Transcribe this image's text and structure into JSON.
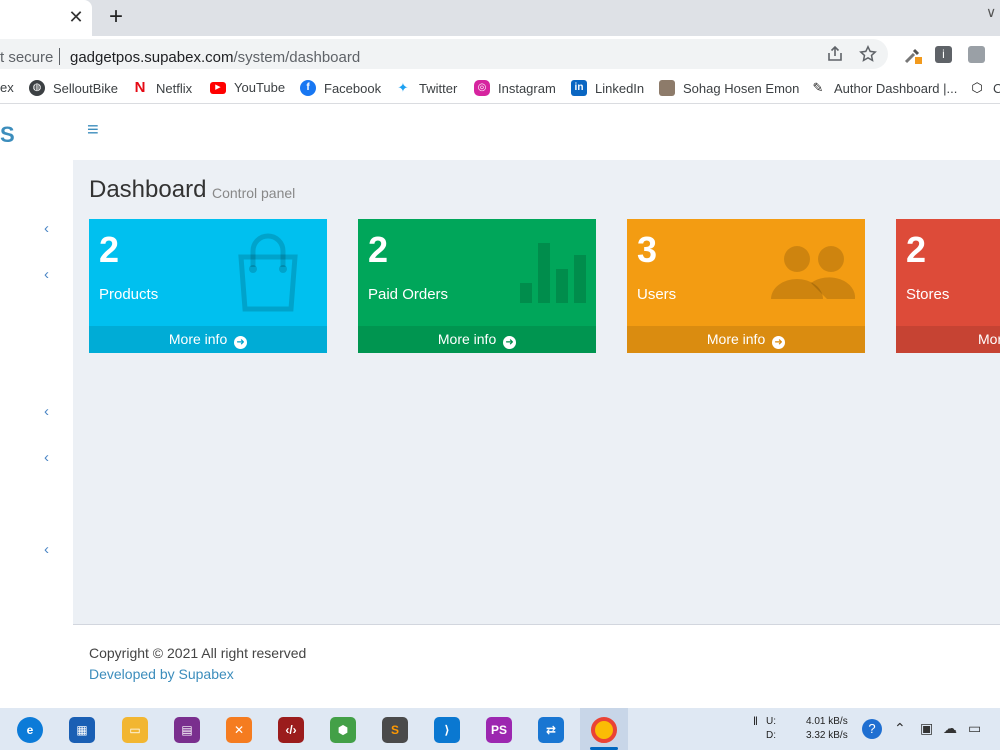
{
  "browser": {
    "security": "t secure",
    "url_host": "gadgetpos.supabex.com",
    "url_path": "/system/dashboard",
    "tab_close": "✕",
    "new_tab": "+",
    "tab_menu": "∨",
    "ext_info": "i"
  },
  "bookmarks": [
    {
      "label": "ex"
    },
    {
      "label": "SelloutBike"
    },
    {
      "label": "Netflix"
    },
    {
      "label": "YouTube"
    },
    {
      "label": "Facebook"
    },
    {
      "label": "Twitter"
    },
    {
      "label": "Instagram"
    },
    {
      "label": "LinkedIn"
    },
    {
      "label": "Sohag Hosen Emon"
    },
    {
      "label": "Author Dashboard |..."
    },
    {
      "label": "C"
    }
  ],
  "app": {
    "logo_fragment": "S",
    "hamburger": "≡",
    "sidebar_chevron": "‹",
    "title": "Dashboard",
    "subtitle": "Control panel"
  },
  "stats": [
    {
      "value": "2",
      "label": "Products",
      "more": "More info",
      "color": "#00c0ef"
    },
    {
      "value": "2",
      "label": "Paid Orders",
      "more": "More info",
      "color": "#00a65a"
    },
    {
      "value": "3",
      "label": "Users",
      "more": "More info",
      "color": "#f39c12"
    },
    {
      "value": "2",
      "label": "Stores",
      "more": "More info",
      "color": "#dd4b39"
    }
  ],
  "footer": {
    "copyright": "Copyright © 2021 All right reserved",
    "developer": "Developed by Supabex"
  },
  "taskbar": {
    "net_up_label": "U:",
    "net_down_label": "D:",
    "net_up": "4.01 kB/s",
    "net_down": "3.32 kB/s"
  }
}
